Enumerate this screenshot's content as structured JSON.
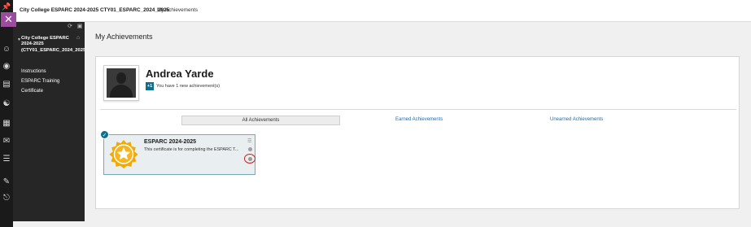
{
  "header": {
    "course_title": "City College ESPARC 2024-2025 CTY01_ESPARC_2024_2025",
    "breadcrumb": "My Achievements"
  },
  "rail": {
    "close_symbol": "✕",
    "icons": [
      "pin-icon",
      "user-icon",
      "globe-icon",
      "courses-icon",
      "organizations-icon",
      "calendar-icon",
      "messages-icon",
      "grades-icon",
      "tools-icon",
      "signout-icon"
    ]
  },
  "sidebar": {
    "course_name": "City College ESPARC 2024-2025 (CTY01_ESPARC_2024_2025)",
    "items": [
      {
        "label": "Instructions"
      },
      {
        "label": "ESPARC Training"
      },
      {
        "label": "Certificate"
      }
    ]
  },
  "main": {
    "page_title": "My Achievements",
    "user_name": "Andrea Yarde",
    "new_badge": "+1",
    "new_text": "You have 1 new achievement(s)",
    "tabs": [
      {
        "label": "All Achievements",
        "selected": true
      },
      {
        "label": "Earned Achievements",
        "selected": false
      },
      {
        "label": "Unearned Achievements",
        "selected": false
      }
    ],
    "achievement": {
      "title": "ESPARC 2024-2025",
      "description": "This certificate is for completing the ESPARC T...",
      "earned": true
    }
  },
  "colors": {
    "accent": "#0d6f8f",
    "close_button": "#9b4c9e",
    "link": "#1a6fb0",
    "medal": "#f2a900",
    "highlight": "#cc2222"
  }
}
